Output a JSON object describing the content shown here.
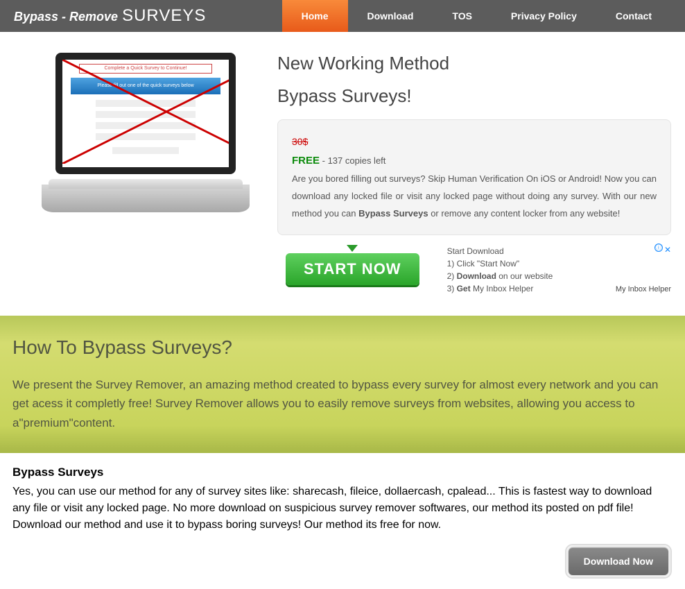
{
  "logo": {
    "a": "Bypass - Remove",
    "b": "SURVEYS"
  },
  "nav": [
    "Home",
    "Download",
    "TOS",
    "Privacy Policy",
    "Contact"
  ],
  "nav_active": 0,
  "hero": {
    "line1": "New Working Method",
    "line2": "Bypass Surveys!",
    "old_price": "30$",
    "free": "FREE",
    "copies": " - 137 copies left",
    "desc_a": "Are you bored filling out surveys? Skip Human Verification On iOS or Android! Now you can download any locked file or visit any locked page without doing any survey. With our new method you can ",
    "desc_bold": "Bypass Surveys",
    "desc_b": " or remove any content locker from any website!",
    "start": "START NOW"
  },
  "laptop": {
    "banner": "Complete a Quick Survey to Continue!",
    "bar": "Please fill out one of the quick surveys below"
  },
  "ad": {
    "l1": "Start Download",
    "l2": "1) Click \"Start Now\"",
    "l3a": "2) ",
    "l3b": "Download",
    "l3c": " on our website",
    "l4a": "3) ",
    "l4b": "Get",
    "l4c": " My Inbox Helper",
    "brand": "My Inbox Helper",
    "info": "ⓘ",
    "close": "✕"
  },
  "green": {
    "title": "How To Bypass Surveys?",
    "body": "We present the Survey Remover, an amazing method created to bypass every survey for almost every network and you can get acess it completly free! Survey Remover allows you to easily remove surveys from websites, allowing you access to a\"premium\"content."
  },
  "bottom": {
    "title": "Bypass Surveys",
    "body": "Yes, you can use our method for any of survey sites like: sharecash, fileice, dollaercash, cpalead... This is fastest way to download any file or visit any locked page. No more download on suspicious survey remover softwares, our method its posted on pdf file! Download our method and use it to bypass boring surveys! Our method its free for now.",
    "btn": "Download Now"
  }
}
